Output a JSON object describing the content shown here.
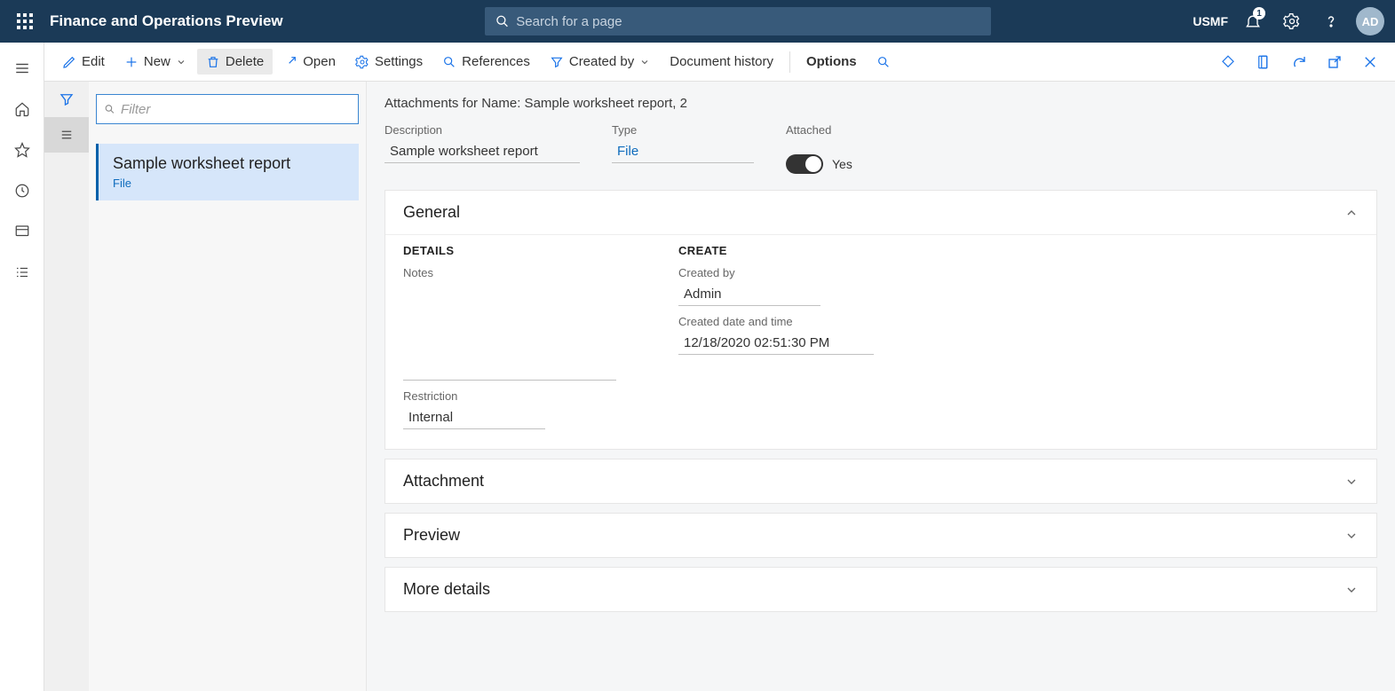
{
  "header": {
    "app_title": "Finance and Operations Preview",
    "search_placeholder": "Search for a page",
    "company": "USMF",
    "notification_count": "1",
    "avatar_initials": "AD"
  },
  "action_bar": {
    "edit": "Edit",
    "new": "New",
    "delete": "Delete",
    "open": "Open",
    "settings": "Settings",
    "references": "References",
    "created_by": "Created by",
    "doc_history": "Document history",
    "options": "Options"
  },
  "side_ribbon": {
    "filter": "filter",
    "list": "list"
  },
  "list": {
    "filter_placeholder": "Filter",
    "items": [
      {
        "title": "Sample worksheet report",
        "subtitle": "File"
      }
    ]
  },
  "details": {
    "title": "Attachments for Name: Sample worksheet report, 2",
    "description_label": "Description",
    "description_value": "Sample worksheet report",
    "type_label": "Type",
    "type_value": "File",
    "attached_label": "Attached",
    "attached_state": "Yes",
    "general": {
      "heading": "General",
      "details_head": "DETAILS",
      "notes_label": "Notes",
      "restriction_label": "Restriction",
      "restriction_value": "Internal",
      "create_head": "CREATE",
      "created_by_label": "Created by",
      "created_by_value": "Admin",
      "created_dt_label": "Created date and time",
      "created_dt_value": "12/18/2020 02:51:30 PM"
    },
    "ft_attachment": "Attachment",
    "ft_preview": "Preview",
    "ft_more": "More details"
  }
}
